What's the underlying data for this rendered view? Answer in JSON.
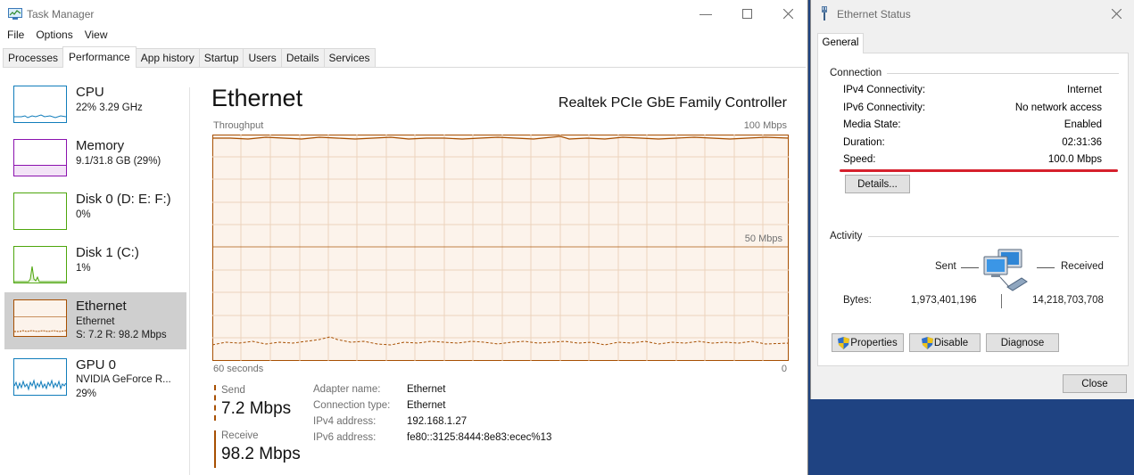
{
  "task_manager": {
    "title": "Task Manager",
    "menu": [
      "File",
      "Options",
      "View"
    ],
    "tabs": [
      "Processes",
      "Performance",
      "App history",
      "Startup",
      "Users",
      "Details",
      "Services"
    ],
    "active_tab": "Performance",
    "sidebar": [
      {
        "name": "CPU",
        "sub1": "22%  3.29 GHz",
        "color": "#117dbb"
      },
      {
        "name": "Memory",
        "sub1": "9.1/31.8 GB (29%)",
        "color": "#8b12ae"
      },
      {
        "name": "Disk 0 (D: E: F:)",
        "sub1": "0%",
        "color": "#4da60c"
      },
      {
        "name": "Disk 1 (C:)",
        "sub1": "1%",
        "color": "#4da60c"
      },
      {
        "name": "Ethernet",
        "sub1": "Ethernet",
        "sub2": "S: 7.2  R: 98.2 Mbps",
        "color": "#a74f01"
      },
      {
        "name": "GPU 0",
        "sub1": "NVIDIA GeForce R...",
        "sub2": "29%",
        "color": "#117dbb"
      }
    ],
    "selected_item": "Ethernet",
    "main": {
      "title": "Ethernet",
      "adapter": "Realtek PCIe GbE Family Controller",
      "graph_title": "Throughput",
      "graph_max": "100 Mbps",
      "graph_mid": "50 Mbps",
      "graph_x_left": "60 seconds",
      "graph_x_right": "0",
      "send_label": "Send",
      "send_value": "7.2 Mbps",
      "receive_label": "Receive",
      "receive_value": "98.2 Mbps",
      "details": [
        {
          "key": "Adapter name:",
          "value": "Ethernet"
        },
        {
          "key": "Connection type:",
          "value": "Ethernet"
        },
        {
          "key": "IPv4 address:",
          "value": "192.168.1.27"
        },
        {
          "key": "IPv6 address:",
          "value": "fe80::3125:8444:8e83:ecec%13"
        }
      ],
      "accent": "#a74f01",
      "graph_fill": "#fcf3eb"
    }
  },
  "ethernet_status": {
    "title": "Ethernet Status",
    "tab": "General",
    "connection_group": "Connection",
    "connection": [
      {
        "key": "IPv4 Connectivity:",
        "value": "Internet"
      },
      {
        "key": "IPv6 Connectivity:",
        "value": "No network access"
      },
      {
        "key": "Media State:",
        "value": "Enabled"
      },
      {
        "key": "Duration:",
        "value": "02:31:36"
      },
      {
        "key": "Speed:",
        "value": "100.0 Mbps"
      }
    ],
    "details_button": "Details...",
    "activity_group": "Activity",
    "sent_label": "Sent",
    "received_label": "Received",
    "bytes_label": "Bytes:",
    "bytes_sent": "1,973,401,196",
    "bytes_received": "14,218,703,708",
    "properties_button": "Properties",
    "disable_button": "Disable",
    "diagnose_button": "Diagnose",
    "close_button": "Close",
    "highlight_color": "#d6202d"
  }
}
